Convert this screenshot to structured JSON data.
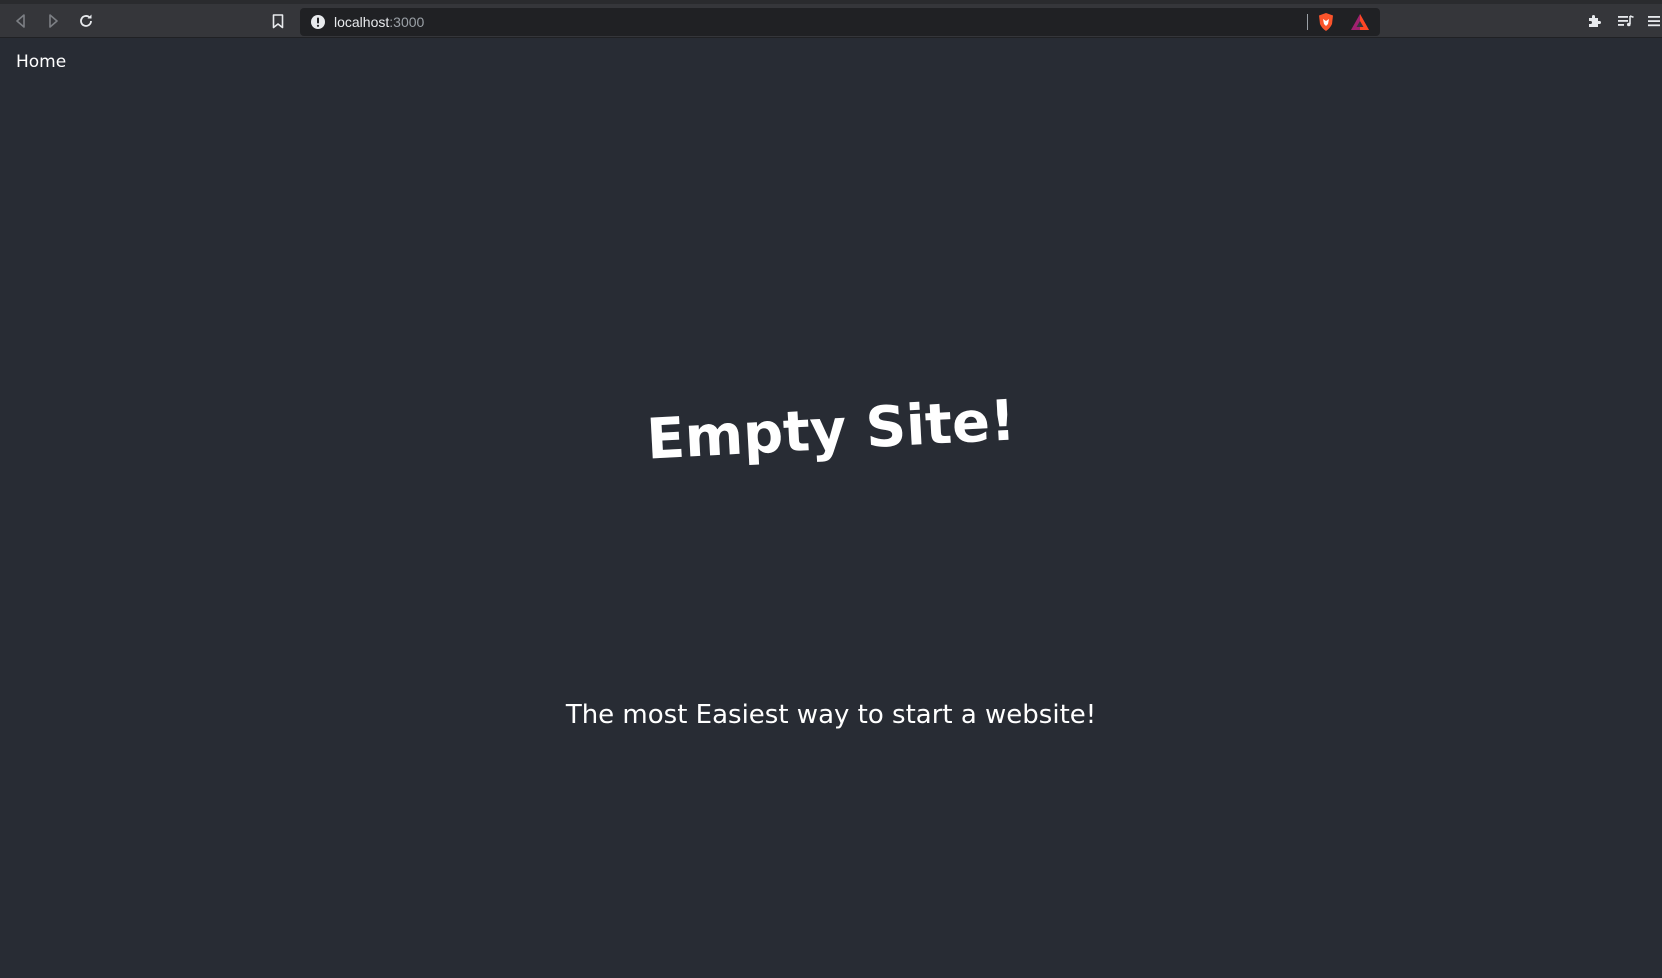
{
  "browser": {
    "url_host": "localhost",
    "url_port": ":3000",
    "icons": {
      "back": "back-arrow-icon",
      "forward": "forward-arrow-icon",
      "reload": "reload-icon",
      "bookmark": "bookmark-icon",
      "site_info": "info-icon",
      "shield": "brave-shield-icon",
      "rewards": "brave-rewards-icon",
      "extensions": "puzzle-icon",
      "playlist": "playlist-icon",
      "menu": "hamburger-menu-icon"
    },
    "colors": {
      "toolbar": "#35363a",
      "address_bar": "#202124",
      "shield": "#fb542b",
      "rewards": "#a0216f"
    }
  },
  "page": {
    "nav_home": "Home",
    "headline": "Empty Site!",
    "tagline": "The most Easiest way to start a website!",
    "colors": {
      "background": "#282c34",
      "text": "#ffffff"
    }
  }
}
